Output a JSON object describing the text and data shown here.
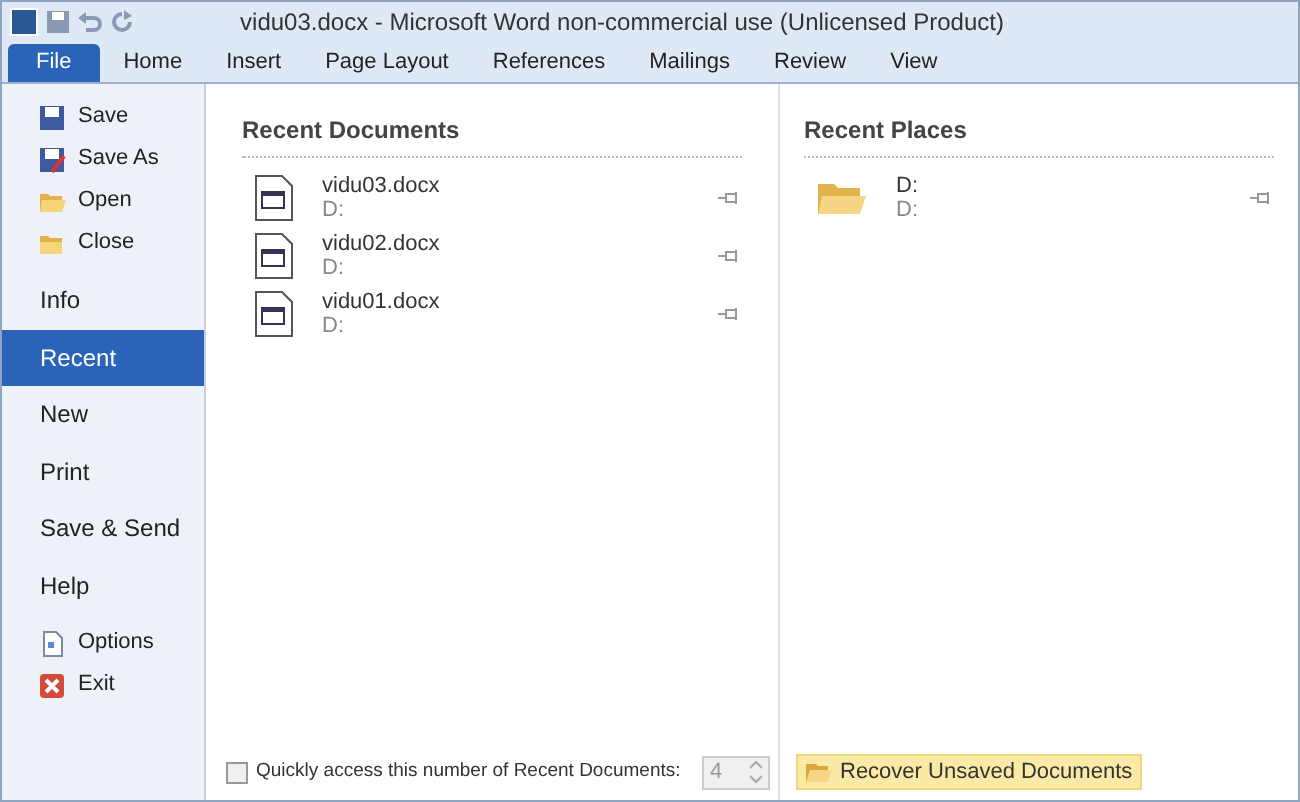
{
  "window": {
    "title": "vidu03.docx  -  Microsoft Word non-commercial use (Unlicensed Product)"
  },
  "tabs": [
    {
      "label": "File",
      "selected": true
    },
    {
      "label": "Home",
      "selected": false
    },
    {
      "label": "Insert",
      "selected": false
    },
    {
      "label": "Page Layout",
      "selected": false
    },
    {
      "label": "References",
      "selected": false
    },
    {
      "label": "Mailings",
      "selected": false
    },
    {
      "label": "Review",
      "selected": false
    },
    {
      "label": "View",
      "selected": false
    }
  ],
  "nav": [
    {
      "kind": "command",
      "label": "Save",
      "selected": false
    },
    {
      "kind": "command",
      "label": "Save As",
      "selected": false
    },
    {
      "kind": "command",
      "label": "Open",
      "selected": false
    },
    {
      "kind": "command",
      "label": "Close",
      "selected": false
    },
    {
      "kind": "page",
      "label": "Info",
      "selected": false
    },
    {
      "kind": "page",
      "label": "Recent",
      "selected": true
    },
    {
      "kind": "page",
      "label": "New",
      "selected": false
    },
    {
      "kind": "page",
      "label": "Print",
      "selected": false
    },
    {
      "kind": "page",
      "label": "Save & Send",
      "selected": false
    },
    {
      "kind": "page",
      "label": "Help",
      "selected": false
    },
    {
      "kind": "command",
      "label": "Options",
      "selected": false
    },
    {
      "kind": "command",
      "label": "Exit",
      "selected": false
    }
  ],
  "recent_documents": {
    "heading": "Recent Documents",
    "items": [
      {
        "name": "vidu03.docx",
        "location": "D:",
        "pinned": false
      },
      {
        "name": "vidu02.docx",
        "location": "D:",
        "pinned": false
      },
      {
        "name": "vidu01.docx",
        "location": "D:",
        "pinned": false
      }
    ]
  },
  "recent_places": {
    "heading": "Recent Places",
    "items": [
      {
        "name": "D:",
        "location": "D:",
        "pinned": false
      }
    ]
  },
  "quick_access": {
    "label": "Quickly access this number of Recent Documents:",
    "checked": false,
    "value": "4",
    "disabled": true
  },
  "recover_button": {
    "label": "Recover Unsaved Documents"
  }
}
